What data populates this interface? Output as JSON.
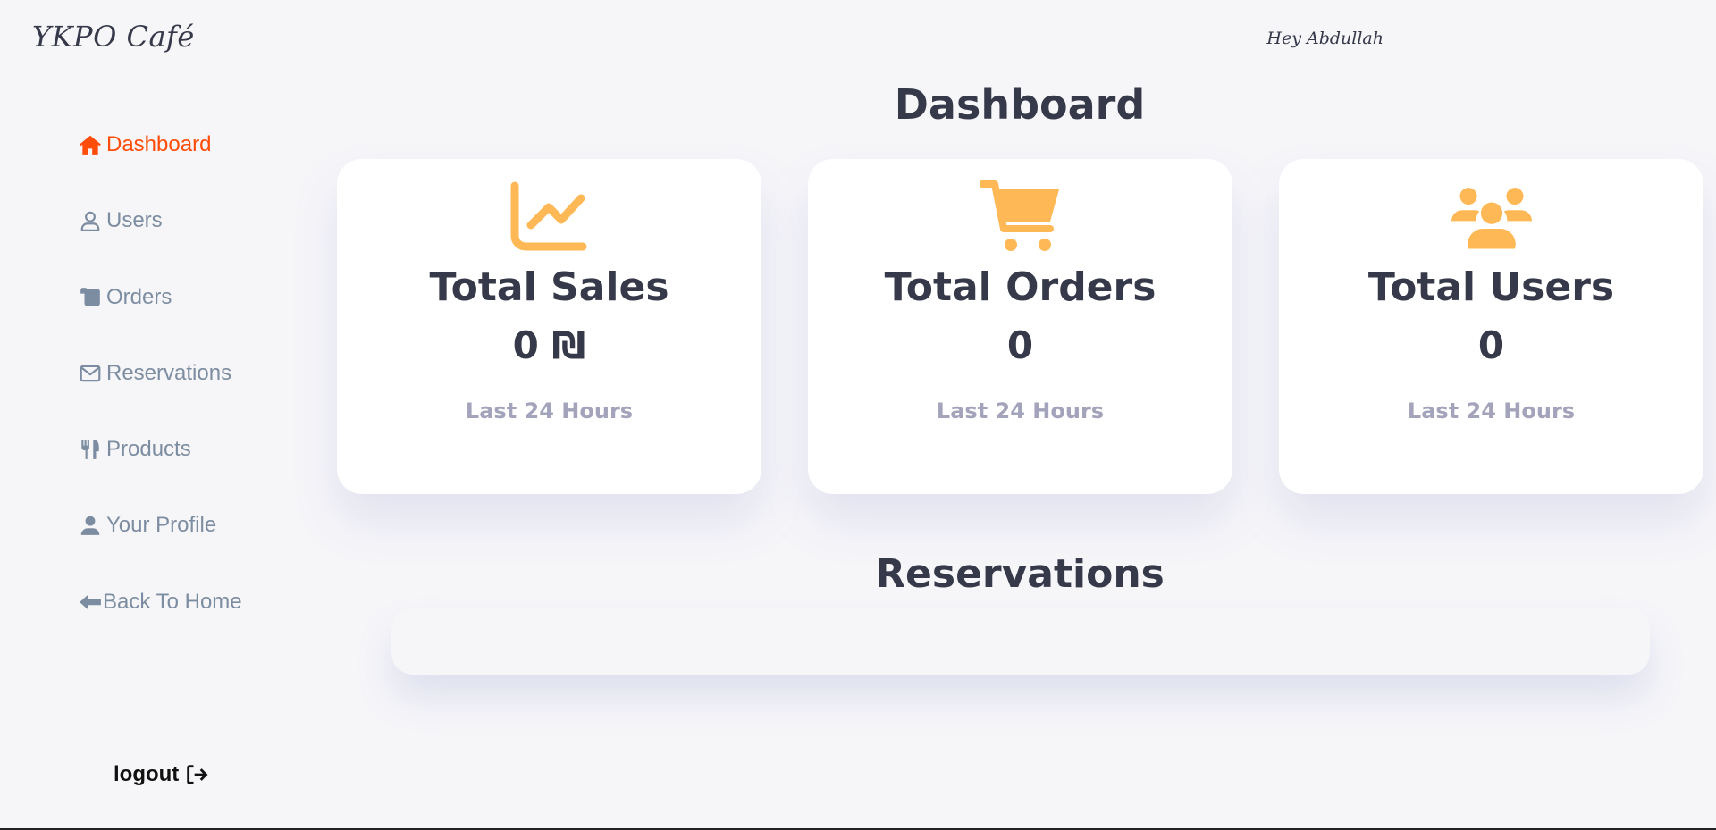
{
  "header": {
    "brand": "YKPO Café",
    "greeting": "Hey Abdullah"
  },
  "sidebar": {
    "items": [
      {
        "label": "Dashboard",
        "icon": "home-icon",
        "active": true
      },
      {
        "label": "Users",
        "icon": "user-outline-icon",
        "active": false
      },
      {
        "label": "Orders",
        "icon": "scroll-icon",
        "active": false
      },
      {
        "label": "Reservations",
        "icon": "envelope-icon",
        "active": false
      },
      {
        "label": "Products",
        "icon": "utensils-icon",
        "active": false
      },
      {
        "label": "Your Profile",
        "icon": "user-solid-icon",
        "active": false
      },
      {
        "label": "Back To Home",
        "icon": "arrow-left-icon",
        "active": false
      }
    ],
    "logout_label": "logout",
    "logout_icon": "sign-out-icon"
  },
  "main": {
    "title": "Dashboard",
    "cards": [
      {
        "title": "Total Sales",
        "value": "0 ₪",
        "subtitle": "Last 24 Hours",
        "icon": "chart-line-icon"
      },
      {
        "title": "Total Orders",
        "value": "0",
        "subtitle": "Last 24 Hours",
        "icon": "cart-icon"
      },
      {
        "title": "Total Users",
        "value": "0",
        "subtitle": "Last 24 Hours",
        "icon": "users-icon"
      }
    ],
    "reservations_title": "Reservations"
  },
  "colors": {
    "accent": "#ff4c08",
    "icon": "#ffb856",
    "text_dark": "#363949",
    "text_muted": "#7d8da1",
    "subtitle": "#a3a3bb",
    "background": "#f6f6f9"
  }
}
